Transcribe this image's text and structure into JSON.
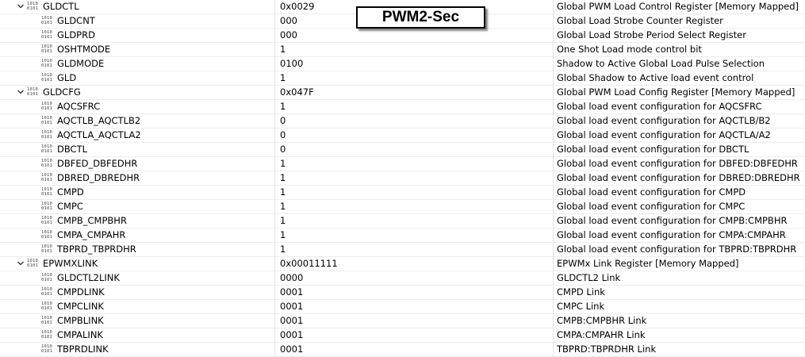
{
  "overlay_label": "PWM2-Sec",
  "registers": [
    {
      "name": "GLDCTL",
      "value": "0x0029",
      "description": "Global PWM Load Control Register [Memory Mapped]",
      "fields": [
        {
          "name": "GLDCNT",
          "value": "000",
          "description": "Global Load Strobe Counter Register"
        },
        {
          "name": "GLDPRD",
          "value": "000",
          "description": "Global Load Strobe Period Select Register"
        },
        {
          "name": "OSHTMODE",
          "value": "1",
          "description": "One Shot Load mode control bit"
        },
        {
          "name": "GLDMODE",
          "value": "0100",
          "description": "Shadow to Active Global Load Pulse Selection"
        },
        {
          "name": "GLD",
          "value": "1",
          "description": "Global Shadow to Active load event control"
        }
      ]
    },
    {
      "name": "GLDCFG",
      "value": "0x047F",
      "description": "Global PWM Load Config Register  [Memory Mapped]",
      "fields": [
        {
          "name": "AQCSFRC",
          "value": "1",
          "description": "Global load event configuration for AQCSFRC"
        },
        {
          "name": "AQCTLB_AQCTLB2",
          "value": "0",
          "description": "Global load event configuration for AQCTLB/B2"
        },
        {
          "name": "AQCTLA_AQCTLA2",
          "value": "0",
          "description": "Global load event configuration for AQCTLA/A2"
        },
        {
          "name": "DBCTL",
          "value": "0",
          "description": "Global load event configuration for DBCTL"
        },
        {
          "name": "DBFED_DBFEDHR",
          "value": "1",
          "description": "Global load event configuration for DBFED:DBFEDHR"
        },
        {
          "name": "DBRED_DBREDHR",
          "value": "1",
          "description": "Global load event configuration for DBRED:DBREDHR"
        },
        {
          "name": "CMPD",
          "value": "1",
          "description": "Global load event configuration for CMPD"
        },
        {
          "name": "CMPC",
          "value": "1",
          "description": "Global load event configuration for CMPC"
        },
        {
          "name": "CMPB_CMPBHR",
          "value": "1",
          "description": "Global load event configuration for CMPB:CMPBHR"
        },
        {
          "name": "CMPA_CMPAHR",
          "value": "1",
          "description": "Global load event configuration for CMPA:CMPAHR"
        },
        {
          "name": "TBPRD_TBPRDHR",
          "value": "1",
          "description": "Global load event configuration for TBPRD:TBPRDHR"
        }
      ]
    },
    {
      "name": "EPWMXLINK",
      "value": "0x00011111",
      "description": "EPWMx Link Register [Memory Mapped]",
      "fields": [
        {
          "name": "GLDCTL2LINK",
          "value": "0000",
          "description": "GLDCTL2 Link"
        },
        {
          "name": "CMPDLINK",
          "value": "0001",
          "description": "CMPD Link"
        },
        {
          "name": "CMPCLINK",
          "value": "0001",
          "description": "CMPC Link"
        },
        {
          "name": "CMPBLINK",
          "value": "0001",
          "description": "CMPB:CMPBHR Link"
        },
        {
          "name": "CMPALINK",
          "value": "0001",
          "description": "CMPA:CMPAHR Link"
        },
        {
          "name": "TBPRDLINK",
          "value": "0001",
          "description": "TBPRD:TBPRDHR  Link"
        }
      ]
    }
  ]
}
